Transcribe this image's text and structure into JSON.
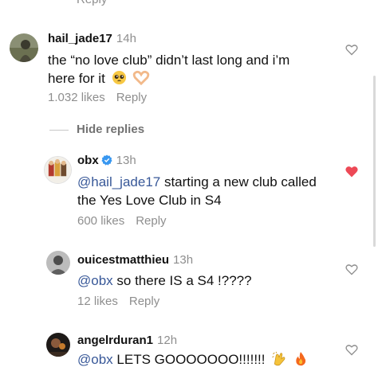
{
  "top_reply_label": "Reply",
  "comments": [
    {
      "username": "hail_jade17",
      "time": "14h",
      "text": "the “no love club” didn’t last long and i’m here for it",
      "emojis": [
        "pleading-face",
        "heart-hands"
      ],
      "likes": "1.032 likes",
      "reply_label": "Reply",
      "liked": false
    },
    {
      "username": "obx",
      "time": "13h",
      "verified": true,
      "mention": "@hail_jade17",
      "text": " starting a new club called the Yes Love Club in S4",
      "likes": "600 likes",
      "reply_label": "Reply",
      "liked": true
    },
    {
      "username": "ouicestmatthieu",
      "time": "13h",
      "mention": "@obx",
      "text": " so there IS a S4 !????",
      "likes": "12 likes",
      "reply_label": "Reply",
      "liked": false
    },
    {
      "username": "angelrduran1",
      "time": "12h",
      "mention": "@obx",
      "text": " LETS GOOOOOOO!!!!!!!",
      "emojis": [
        "clapping-hands",
        "fire"
      ],
      "liked": false
    }
  ],
  "hide_replies_label": "Hide replies",
  "colors": {
    "liked_heart": "#ed4956",
    "muted_text": "#8e8e8e",
    "mention": "#385898",
    "verified": "#3897f0"
  }
}
